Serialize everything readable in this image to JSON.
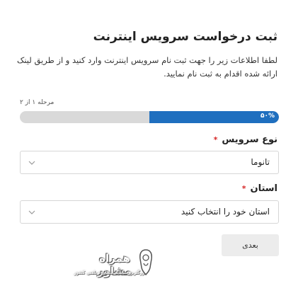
{
  "form": {
    "title": "ثبت درخواست سرویس اینترنت",
    "description": "لطفا اطلاعات زیر را جهت ثبت نام سرویس اینترنت وارد کنید و از طریق لینک ارائه شده اقدام به ثبت نام نمایید.",
    "step_text": "مرحله ۱ از ۲",
    "progress": {
      "percent": 50,
      "label": "۵۰%"
    },
    "service_type": {
      "label": "نوع سرویس",
      "required_mark": "*",
      "value": "تانوما"
    },
    "province": {
      "label": "استان",
      "required_mark": "*",
      "value": "استان خود را انتخاب کنید"
    },
    "next_label": "بعدی"
  },
  "watermark": {
    "title": "همراه مشاور",
    "subtitle": "بزرگترین سامانه مشاوره تلفنی کشور"
  },
  "colors": {
    "accent": "#1f6fbf",
    "required": "#d62828",
    "track": "#d9d9d9"
  },
  "icons": {
    "select_arrow": "chevron-down-icon"
  }
}
